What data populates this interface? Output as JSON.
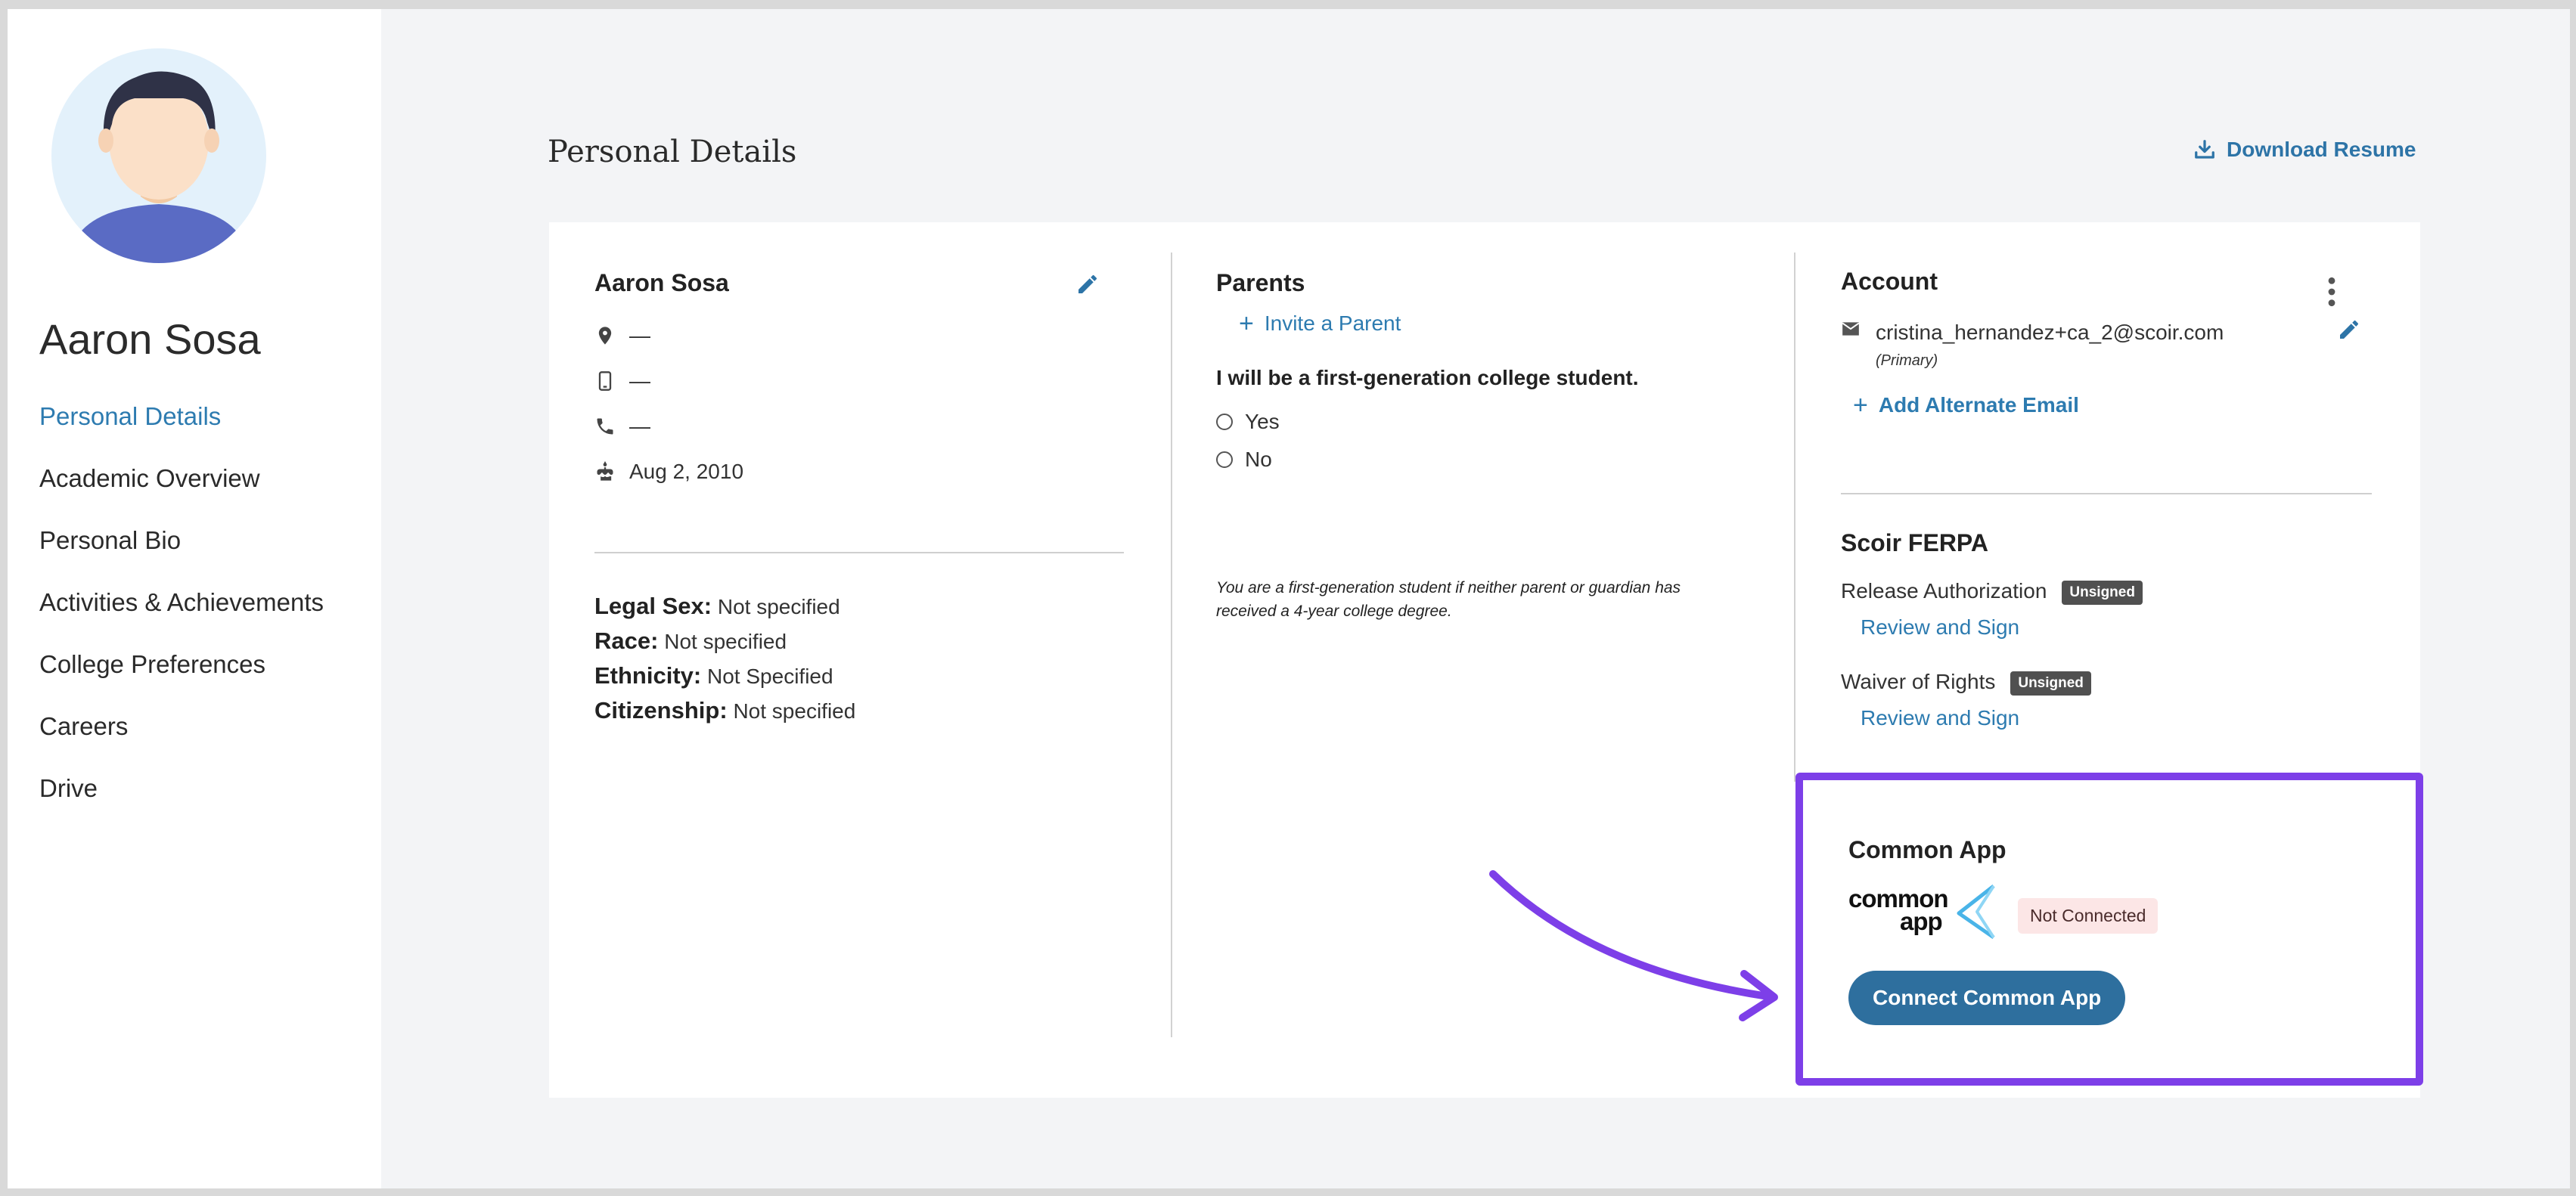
{
  "student": {
    "name": "Aaron Sosa"
  },
  "nav": {
    "items": [
      "Personal Details",
      "Academic Overview",
      "Personal Bio",
      "Activities & Achievements",
      "College Preferences",
      "Careers",
      "Drive"
    ],
    "active_index": 0
  },
  "page": {
    "title": "Personal Details",
    "download_label": "Download Resume"
  },
  "profile": {
    "name": "Aaron Sosa",
    "address": "—",
    "mobile": "—",
    "phone": "—",
    "birthdate": "Aug 2, 2010",
    "demographics": [
      {
        "label": "Legal Sex:",
        "value": "Not specified"
      },
      {
        "label": "Race:",
        "value": "Not specified"
      },
      {
        "label": "Ethnicity:",
        "value": "Not Specified"
      },
      {
        "label": "Citizenship:",
        "value": "Not specified"
      }
    ]
  },
  "parents": {
    "title": "Parents",
    "invite_label": "Invite a Parent",
    "question": "I will be a first-generation college student.",
    "options": [
      "Yes",
      "No"
    ],
    "note": "You are a first-generation student if neither parent or guardian has received a 4-year college degree."
  },
  "account": {
    "title": "Account",
    "email": "cristina_hernandez+ca_2@scoir.com",
    "email_tag": "(Primary)",
    "add_email_label": "Add Alternate Email"
  },
  "ferpa": {
    "title": "Scoir FERPA",
    "items": [
      {
        "label": "Release Authorization",
        "status": "Unsigned",
        "action": "Review and Sign"
      },
      {
        "label": "Waiver of Rights",
        "status": "Unsigned",
        "action": "Review and Sign"
      }
    ]
  },
  "common_app": {
    "title": "Common App",
    "logo_line1": "common",
    "logo_line2": "app",
    "status": "Not Connected",
    "connect_label": "Connect Common App"
  },
  "colors": {
    "link": "#2d7bb0",
    "highlight": "#7d3fe8",
    "button": "#2e6f9e"
  }
}
